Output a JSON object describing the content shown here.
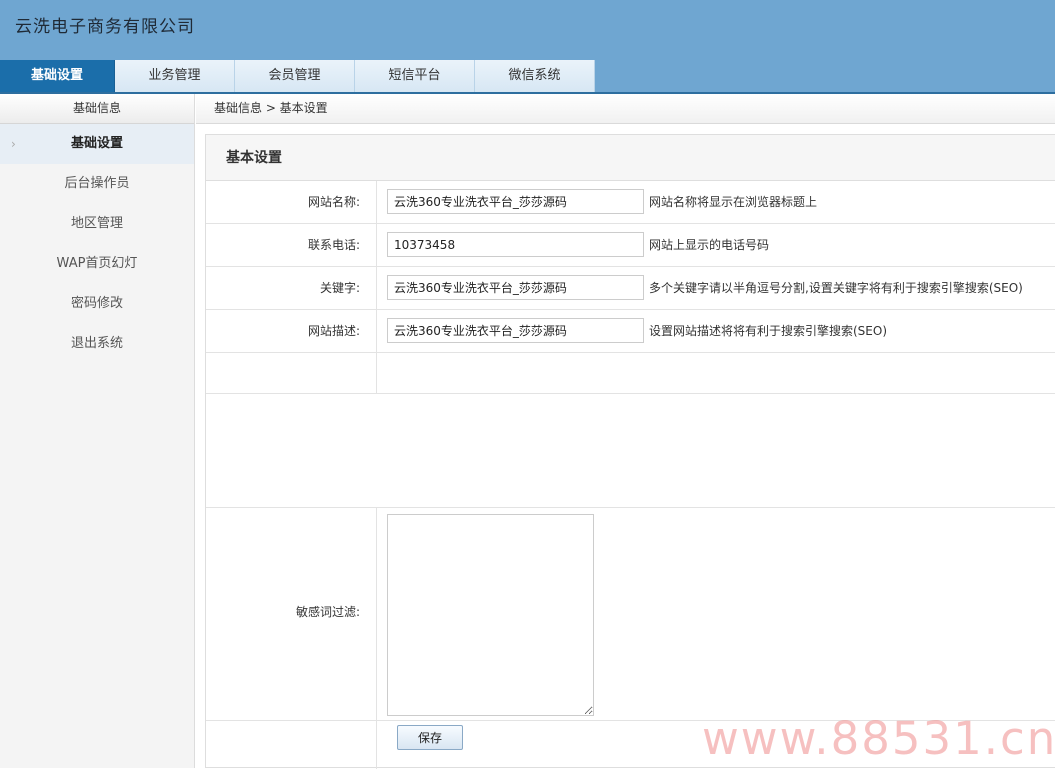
{
  "header": {
    "brand": "云洗电子商务有限公司",
    "nav": [
      "基础设置",
      "业务管理",
      "会员管理",
      "短信平台",
      "微信系统"
    ]
  },
  "sidebar": {
    "title": "基础信息",
    "items": [
      {
        "label": "基础设置",
        "active": true
      },
      {
        "label": "后台操作员"
      },
      {
        "label": "地区管理"
      },
      {
        "label": "WAP首页幻灯"
      },
      {
        "label": "密码修改"
      },
      {
        "label": "退出系统"
      }
    ],
    "arrow": "›"
  },
  "breadcrumb": "基础信息 > 基本设置",
  "panel": {
    "title": "基本设置",
    "fields": [
      {
        "label": "网站名称:",
        "value": "云洗360专业洗衣平台_莎莎源码",
        "hint": "网站名称将显示在浏览器标题上"
      },
      {
        "label": "联系电话:",
        "value": "10373458",
        "hint": "网站上显示的电话号码"
      },
      {
        "label": "关键字:",
        "value": "云洗360专业洗衣平台_莎莎源码",
        "hint": "多个关键字请以半角逗号分割,设置关键字将有利于搜索引擎搜索(SEO)"
      },
      {
        "label": "网站描述:",
        "value": "云洗360专业洗衣平台_莎莎源码",
        "hint": "设置网站描述将将有利于搜索引擎搜索(SEO)"
      }
    ],
    "sensitive_label": "敏感词过滤:",
    "sensitive_value": "",
    "save_label": "保存"
  },
  "watermark": "www.88531.cn"
}
